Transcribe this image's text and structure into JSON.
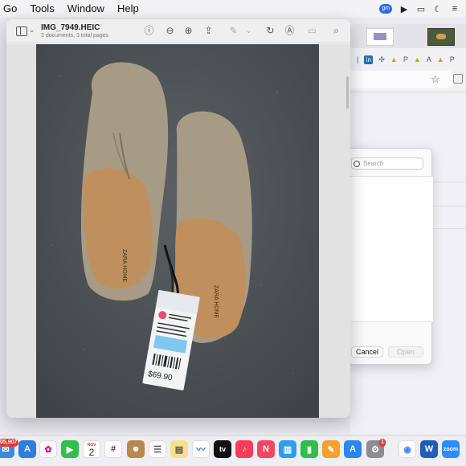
{
  "menubar": {
    "menus": [
      "Go",
      "Tools",
      "Window",
      "Help"
    ],
    "status_badge": "gm"
  },
  "preview": {
    "title": "IMG_7949.HEIC",
    "subtitle": "3 documents, 3 total pages",
    "price_tag": "$69.90",
    "insole_brand": "ZARA HOME"
  },
  "chrome": {
    "bookmark_labels": [
      "P",
      "A",
      "P"
    ]
  },
  "dialog": {
    "search_placeholder": "Search",
    "cancel_label": "Cancel",
    "open_label": "Open"
  },
  "dock": {
    "calendar_month": "NOV",
    "calendar_day": "2",
    "badge_left": "05,907",
    "badge_settings": "1",
    "zoom_label": "zoom"
  },
  "colors": {
    "accent": "#2b6de8",
    "preview_background": "#4d5256",
    "price_tag": "#e94b72"
  }
}
